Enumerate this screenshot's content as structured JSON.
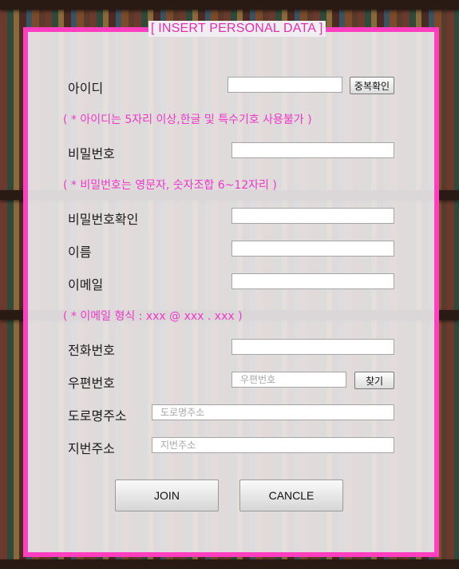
{
  "form": {
    "legend": "[ INSERT PERSONAL DATA ]",
    "id": {
      "label": "아이디",
      "value": "",
      "check_button": "중복확인",
      "note": "( * 아이디는 5자리 이상,한글 및 특수기호 사용불가 )"
    },
    "password": {
      "label": "비밀번호",
      "value": "",
      "note": "( * 비밀번호는 영문자, 숫자조합 6~12자리 )"
    },
    "password_confirm": {
      "label": "비밀번호확인",
      "value": ""
    },
    "name": {
      "label": "이름",
      "value": ""
    },
    "email": {
      "label": "이메일",
      "value": "",
      "note": "( * 이메일 형식 : xxx @ xxx . xxx )"
    },
    "phone": {
      "label": "전화번호",
      "value": ""
    },
    "zipcode": {
      "label": "우편번호",
      "placeholder": "우편번호",
      "find_button": "찾기"
    },
    "road_address": {
      "label": "도로명주소",
      "placeholder": "도로명주소"
    },
    "lot_address": {
      "label": "지번주소",
      "placeholder": "지번주소"
    },
    "buttons": {
      "join": "JOIN",
      "cancel": "CANCLE"
    }
  },
  "colors": {
    "accent": "#ff3fbf",
    "note_text": "#f037c8",
    "panel_bg": "#eeecee"
  }
}
